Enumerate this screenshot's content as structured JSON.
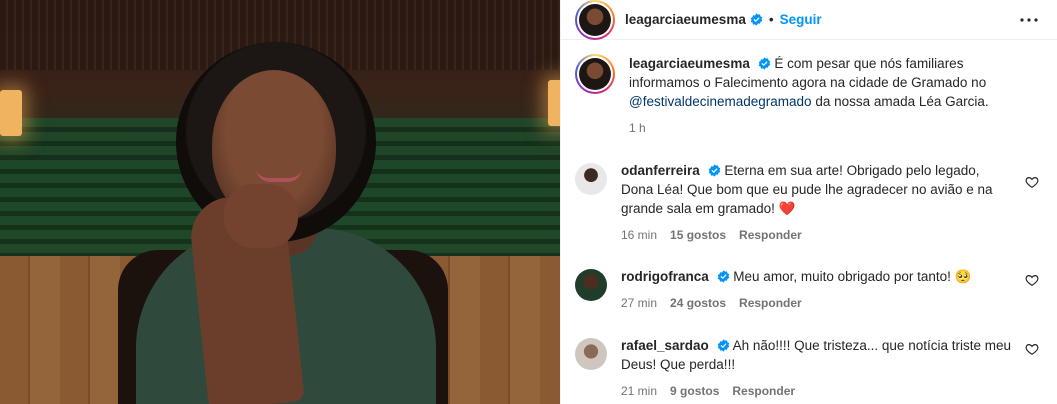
{
  "post": {
    "author": {
      "username": "leagarciaeumesma",
      "verified": true,
      "follow_label": "Seguir",
      "more_icon": "more-horizontal-icon"
    },
    "caption": {
      "username": "leagarciaeumesma",
      "text_before_mention": "É com pesar que nós familiares informamos o Falecimento agora na cidade de Gramado no",
      "mention": "@festivaldecinemadegramado",
      "text_after_mention": "da nossa amada Léa Garcia.",
      "time": "1 h"
    },
    "comments": [
      {
        "username": "odanferreira",
        "verified": true,
        "text": "Eterna em sua arte! Obrigado pelo legado, Dona Léa! Que bom que eu pude lhe agradecer no avião e na grande sala em gramado!",
        "emoji": "❤️",
        "time": "16 min",
        "likes": "15 gostos",
        "reply": "Responder"
      },
      {
        "username": "rodrigofranca",
        "verified": true,
        "text": "Meu amor, muito obrigado por tanto!",
        "emoji": "🥺",
        "time": "27 min",
        "likes": "24 gostos",
        "reply": "Responder"
      },
      {
        "username": "rafael_sardao",
        "verified": true,
        "text": "Ah não!!!! Que tristeza... que notícia triste meu Deus! Que perda!!!",
        "emoji": "",
        "time": "21 min",
        "likes": "9 gostos",
        "reply": "Responder"
      }
    ]
  },
  "colors": {
    "accent": "#0095f6",
    "verified": "#0095f6",
    "mention": "#00376b",
    "secondary_text": "#737373",
    "heart_emoji": "#e0245e"
  }
}
